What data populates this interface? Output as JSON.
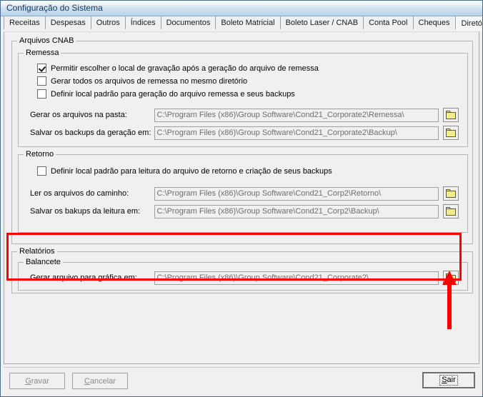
{
  "window": {
    "title": "Configuração do Sistema"
  },
  "tabs": [
    {
      "label": "Receitas",
      "active": false
    },
    {
      "label": "Despesas",
      "active": false
    },
    {
      "label": "Outros",
      "active": false
    },
    {
      "label": "Índices",
      "active": false
    },
    {
      "label": "Documentos",
      "active": false
    },
    {
      "label": "Boleto Matricial",
      "active": false
    },
    {
      "label": "Boleto Laser / CNAB",
      "active": false
    },
    {
      "label": "Conta Pool",
      "active": false
    },
    {
      "label": "Cheques",
      "active": false
    },
    {
      "label": "Diretórios",
      "active": true
    }
  ],
  "groups": {
    "arquivos_cnab": {
      "caption": "Arquivos CNAB"
    },
    "remessa": {
      "caption": "Remessa",
      "checkboxes": [
        {
          "label": "Permitir escolher o local de gravação após a geração do arquivo de remessa",
          "checked": true
        },
        {
          "label": "Gerar todos os arquivos de remessa no mesmo diretório",
          "checked": false
        },
        {
          "label": "Definir local padrão para geração do arquivo remessa e seus backups",
          "checked": false
        }
      ],
      "paths": [
        {
          "label": "Gerar os arquivos na pasta:",
          "value": "C:\\Program Files (x86)\\Group Software\\Cond21_Corporate2\\Remessa\\",
          "browse_icon": "folder-icon"
        },
        {
          "label": "Salvar os backups da geração em:",
          "value": "C:\\Program Files (x86)\\Group Software\\Cond21_Corporate2\\Backup\\",
          "browse_icon": "folder-icon"
        }
      ]
    },
    "retorno": {
      "caption": "Retorno",
      "checkboxes": [
        {
          "label": "Definir local padrão para leitura do arquivo de retorno e criação de seus backups",
          "checked": false
        }
      ],
      "paths": [
        {
          "label": "Ler os arquivos do caminho:",
          "value": "C:\\Program Files (x86)\\Group Software\\Cond21_Corp2\\Retorno\\",
          "browse_icon": "folder-icon"
        },
        {
          "label": "Salvar os bakups da leitura em:",
          "value": "C:\\Program Files (x86)\\Group Software\\Cond21_Corp2\\Backup\\",
          "browse_icon": "folder-icon"
        }
      ]
    },
    "relatorios": {
      "caption": "Relatórios"
    },
    "balancete": {
      "caption": "Balancete",
      "paths": [
        {
          "label": "Gerar arquivo para gráfica em:",
          "value": "C:\\Program Files (x86)\\Group Software\\Cond21_Corporate2\\",
          "browse_icon": "folder-icon"
        }
      ]
    }
  },
  "annotation": {
    "highlight_color": "#ff0000",
    "arrow_color": "#ff0000"
  },
  "buttons": {
    "gravar": {
      "label": "Gravar",
      "accel": "G",
      "enabled": false
    },
    "cancelar": {
      "label": "Cancelar",
      "accel": "C",
      "enabled": false
    },
    "sair": {
      "label": "Sair",
      "accel": "S",
      "enabled": true,
      "focused": true
    }
  }
}
